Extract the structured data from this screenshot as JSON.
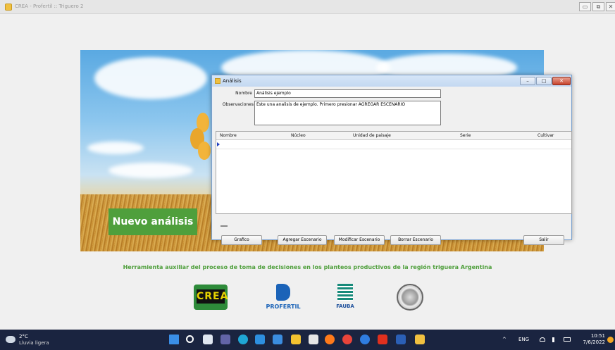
{
  "app": {
    "title": "CREA - Profertil :: Triguero 2",
    "minimize_glyph": "▭",
    "restore_glyph": "⧉",
    "close_glyph": "✕"
  },
  "splash": {
    "nuevo_analisis_label": "Nuevo análisis",
    "tagline": "Herramienta auxiliar del proceso de toma de decisiones en los planteos productivos de la región triguera Argentina",
    "logos": {
      "crea": "CREA",
      "profertil": "PROFERTIL",
      "fauba": "FAUBA"
    }
  },
  "dialog": {
    "title": "Análisis",
    "minimize_glyph": "–",
    "maximize_glyph": "□",
    "close_glyph": "✕",
    "nombre_label": "Nombre",
    "nombre_value": "Análisis ejemplo",
    "observaciones_label": "Observaciones",
    "observaciones_value": "Este una analisis de ejemplo. Primero presionar AGREGAR ESCENARIO",
    "grid": {
      "columns": [
        "Nombre",
        "Núcleo",
        "Unidad de paisaje",
        "Serie",
        "Cultivar"
      ],
      "rows": []
    },
    "buttons": {
      "grafico": "Grafico",
      "agregar": "Agregar Escenario",
      "modificar": "Modificar Escenario",
      "borrar": "Borrar Escenario",
      "salir": "Salir"
    }
  },
  "taskbar": {
    "weather_temp": "2°C",
    "weather_desc": "Lluvia ligera",
    "tray_chevron": "^",
    "language": "ENG",
    "time": "10:51",
    "date": "7/6/2022",
    "icons": [
      "windows-icon",
      "search-icon",
      "task-view-icon",
      "chat-icon",
      "edge-icon",
      "store-icon",
      "mail-icon",
      "explorer-icon",
      "app-icon",
      "firefox-icon",
      "chrome-icon",
      "help-icon",
      "acrobat-icon",
      "word-icon",
      "crea-app-icon"
    ],
    "colors": {
      "windows-icon": "#3a8ee6",
      "search-icon": "#ffffff",
      "task-view-icon": "#dfe6f0",
      "chat-icon": "#6264a7",
      "edge-icon": "#1fa7d6",
      "store-icon": "#2d8fe0",
      "mail-icon": "#3b8de0",
      "explorer-icon": "#f2c230",
      "app-icon": "#e6e6e6",
      "firefox-icon": "#ff7a1a",
      "chrome-icon": "#e8443a",
      "help-icon": "#2f7de1",
      "acrobat-icon": "#e0301e",
      "word-icon": "#2b5fb5",
      "crea-app-icon": "#f0c040"
    }
  },
  "colors": {
    "accent_green": "#4f9f3c",
    "taskbar": "#1a2440"
  }
}
